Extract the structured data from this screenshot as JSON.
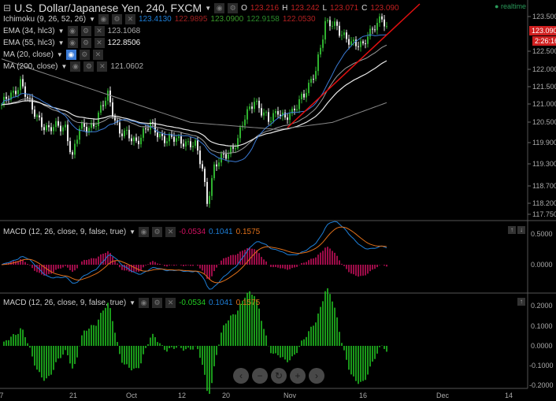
{
  "header": {
    "symbol": "U.S. Dollar/Japanese Yen, 240, FXCM",
    "o_label": "O",
    "o": "123.216",
    "h_label": "H",
    "h": "123.242",
    "l_label": "L",
    "l": "123.071",
    "c_label": "C",
    "c": "123.090",
    "status": "realtime"
  },
  "indicators": [
    {
      "label": "Ichimoku (9, 26, 52, 26)",
      "values": [
        "123.4130",
        "122.9895",
        "123.0900",
        "122.9158",
        "122.0530"
      ]
    },
    {
      "label": "EMA (34, hlc3)",
      "values": [
        "123.1068"
      ]
    },
    {
      "label": "EMA (55, hlc3)",
      "values": [
        "122.8506"
      ]
    },
    {
      "label": "MA (20, close)",
      "values": []
    },
    {
      "label": "MA (200, close)",
      "values": [
        "121.0602"
      ]
    }
  ],
  "macd_panes": [
    {
      "label": "MACD (12, 26, close, 9, false, true)",
      "values": [
        "-0.0534",
        "0.1041",
        "0.1575"
      ]
    },
    {
      "label": "MACD (12, 26, close, 9, false, true)",
      "values": [
        "-0.0534",
        "0.1041",
        "0.1575"
      ]
    }
  ],
  "price_axis": [
    "123.500",
    "122.500",
    "122.000",
    "121.500",
    "121.000",
    "120.500",
    "119.900",
    "119.300",
    "118.700",
    "118.200",
    "117.750"
  ],
  "price_tag": "123.090",
  "countdown": "2:26:16",
  "macd_axis_1": [
    "0.5000",
    "0.0000"
  ],
  "macd_axis_2": [
    "0.2000",
    "0.1000",
    "0.0000",
    "-0.1000",
    "-0.2000"
  ],
  "x_axis": [
    "7",
    "21",
    "Oct",
    "12",
    "20",
    "Nov",
    "16",
    "Dec",
    "14"
  ],
  "nav": {
    "prev": "‹",
    "zoom_out": "−",
    "reset": "↻",
    "zoom_in": "+",
    "next": "›"
  },
  "colors": {
    "up": "#2fb12f",
    "down": "#e8e8e8",
    "trend": "#e01010",
    "macd": "#1e7fd8",
    "signal": "#e0701a",
    "hist1": "#d01060",
    "hist2": "#22cc22"
  },
  "chart_data": {
    "type": "candlestick",
    "title": "U.S. Dollar/Japanese Yen, 240, FXCM",
    "close_keypoints": [
      [
        0,
        121.0
      ],
      [
        5,
        121.3
      ],
      [
        8,
        121.7
      ],
      [
        13,
        120.8
      ],
      [
        20,
        120.3
      ],
      [
        27,
        120.4
      ],
      [
        30,
        119.5
      ],
      [
        33,
        120.3
      ],
      [
        40,
        120.5
      ],
      [
        45,
        121.3
      ],
      [
        50,
        120.2
      ],
      [
        57,
        120.0
      ],
      [
        63,
        120.4
      ],
      [
        70,
        120.0
      ],
      [
        77,
        120.0
      ],
      [
        82,
        119.8
      ],
      [
        85,
        119.2
      ],
      [
        87,
        118.3
      ],
      [
        90,
        119.2
      ],
      [
        95,
        119.6
      ],
      [
        100,
        120.0
      ],
      [
        103,
        120.6
      ],
      [
        107,
        121.2
      ],
      [
        110,
        120.8
      ],
      [
        113,
        120.5
      ],
      [
        117,
        120.9
      ],
      [
        120,
        120.6
      ],
      [
        123,
        120.7
      ],
      [
        127,
        121.3
      ],
      [
        130,
        121.5
      ],
      [
        133,
        121.9
      ],
      [
        137,
        123.4
      ],
      [
        140,
        123.3
      ],
      [
        143,
        123.0
      ],
      [
        147,
        122.9
      ],
      [
        150,
        122.7
      ],
      [
        153,
        122.6
      ],
      [
        155,
        123.0
      ],
      [
        158,
        123.3
      ],
      [
        161,
        123.4
      ],
      [
        163,
        123.09
      ]
    ],
    "ma200_keypoints": [
      [
        0,
        122.3
      ],
      [
        40,
        121.4
      ],
      [
        80,
        120.5
      ],
      [
        117,
        120.3
      ],
      [
        140,
        120.5
      ],
      [
        163,
        121.06
      ]
    ],
    "ylim": [
      117.75,
      123.9
    ]
  }
}
